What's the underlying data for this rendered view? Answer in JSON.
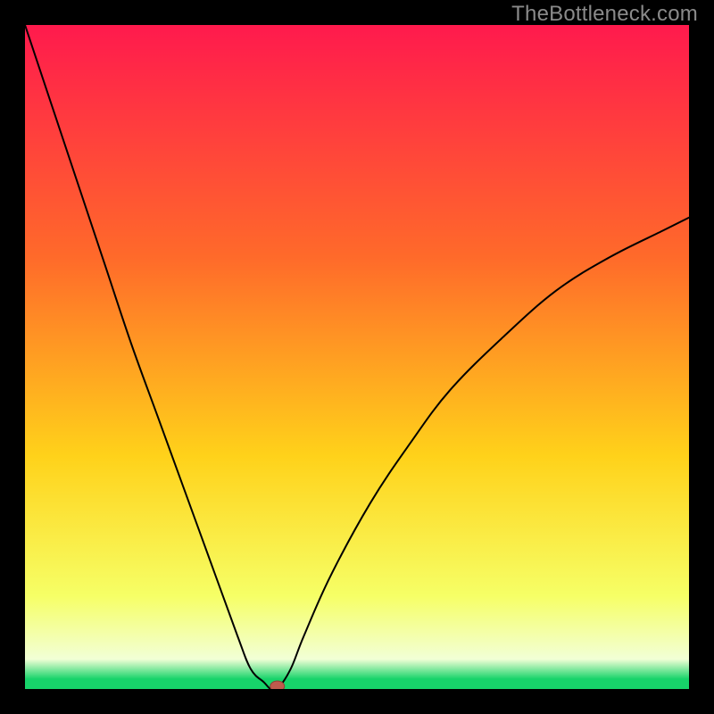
{
  "watermark": "TheBottleneck.com",
  "colors": {
    "frame": "#000000",
    "curve": "#000000",
    "marker_fill": "#c05a4d",
    "marker_stroke": "#8f3f35",
    "grad_top": "#ff1a4d",
    "grad_upper": "#ff6a2a",
    "grad_mid": "#ffd21a",
    "grad_low": "#f6ff66",
    "grad_pale": "#f2ffd6",
    "grad_green": "#17d36a"
  },
  "chart_data": {
    "type": "line",
    "title": "",
    "xlabel": "",
    "ylabel": "",
    "xlim": [
      0,
      100
    ],
    "ylim": [
      0,
      100
    ],
    "series": [
      {
        "name": "bottleneck-curve",
        "x": [
          0,
          4,
          8,
          12,
          16,
          20,
          24,
          28,
          32,
          34,
          36,
          37,
          38,
          40,
          42,
          46,
          52,
          58,
          64,
          72,
          80,
          88,
          96,
          100
        ],
        "values": [
          100,
          88,
          76,
          64,
          52,
          41,
          30,
          19,
          8,
          3,
          1,
          0,
          0,
          3,
          8,
          17,
          28,
          37,
          45,
          53,
          60,
          65,
          69,
          71
        ]
      }
    ],
    "flat_bottom": {
      "x_start": 36,
      "x_end": 38,
      "y": 0
    },
    "marker": {
      "x": 38,
      "y": 0
    },
    "gradient_stops": [
      {
        "offset": 0.0,
        "key": "grad_top"
      },
      {
        "offset": 0.35,
        "key": "grad_upper"
      },
      {
        "offset": 0.65,
        "key": "grad_mid"
      },
      {
        "offset": 0.86,
        "key": "grad_low"
      },
      {
        "offset": 0.955,
        "key": "grad_pale"
      },
      {
        "offset": 0.985,
        "key": "grad_green"
      },
      {
        "offset": 1.0,
        "key": "grad_green"
      }
    ]
  }
}
